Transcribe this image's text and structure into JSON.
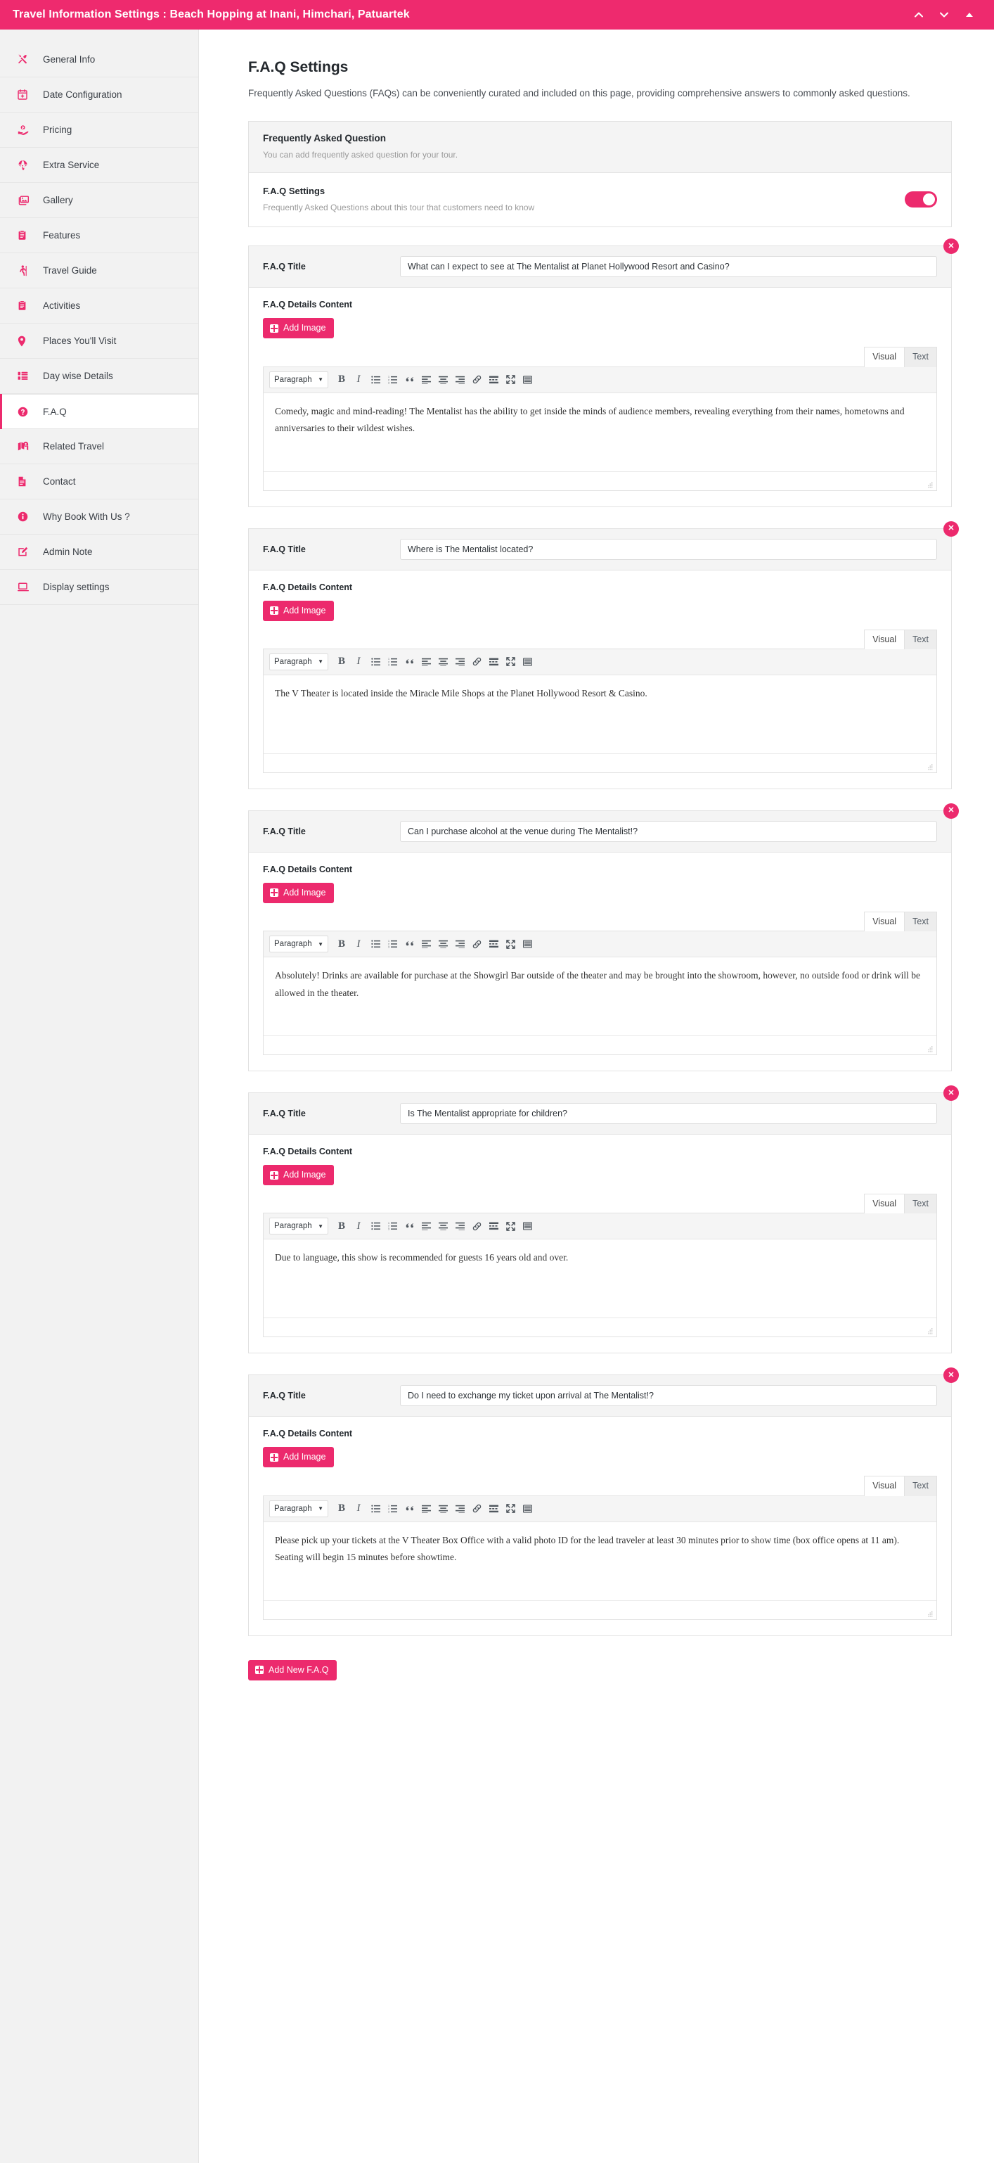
{
  "window": {
    "title": "Travel Information Settings : Beach Hopping at Inani, Himchari, Patuartek",
    "controls": [
      {
        "name": "chevron-up-icon"
      },
      {
        "name": "chevron-down-icon"
      },
      {
        "name": "triangle-up-icon"
      }
    ],
    "accent_color": "#ec2a6d",
    "titlebar_color": "#ee2a6e"
  },
  "sidebar": {
    "items": [
      {
        "label": "General Info",
        "icon": "tools-icon",
        "active": false
      },
      {
        "label": "Date Configuration",
        "icon": "calendar-plus-icon",
        "active": false
      },
      {
        "label": "Pricing",
        "icon": "hand-money-icon",
        "active": false
      },
      {
        "label": "Extra Service",
        "icon": "parachute-icon",
        "active": false
      },
      {
        "label": "Gallery",
        "icon": "images-icon",
        "active": false
      },
      {
        "label": "Features",
        "icon": "clipboard-icon",
        "active": false
      },
      {
        "label": "Travel Guide",
        "icon": "hiker-icon",
        "active": false
      },
      {
        "label": "Activities",
        "icon": "clipboard-icon",
        "active": false
      },
      {
        "label": "Places You'll Visit",
        "icon": "map-pin-icon",
        "active": false
      },
      {
        "label": "Day wise Details",
        "icon": "list-icon",
        "active": false
      },
      {
        "label": "F.A.Q",
        "icon": "question-circle-icon",
        "active": true
      },
      {
        "label": "Related Travel",
        "icon": "map-marked-icon",
        "active": false
      },
      {
        "label": "Contact",
        "icon": "file-lines-icon",
        "active": false
      },
      {
        "label": "Why Book With Us ?",
        "icon": "info-circle-icon",
        "active": false
      },
      {
        "label": "Admin Note",
        "icon": "edit-square-icon",
        "active": false
      },
      {
        "label": "Display settings",
        "icon": "monitor-icon",
        "active": false
      }
    ]
  },
  "page": {
    "title": "F.A.Q Settings",
    "description": "Frequently Asked Questions (FAQs) can be conveniently curated and included on this page, providing comprehensive answers to commonly asked questions."
  },
  "settings_card": {
    "header_title": "Frequently Asked Question",
    "header_sub": "You can add frequently asked question for your tour.",
    "row_title": "F.A.Q Settings",
    "row_sub": "Frequently Asked Questions about this tour that customers need to know",
    "toggle_on": true
  },
  "labels": {
    "faq_title": "F.A.Q Title",
    "faq_details": "F.A.Q Details Content",
    "add_image": "Add Image",
    "add_new_faq": "Add New F.A.Q",
    "tab_visual": "Visual",
    "tab_text": "Text",
    "paragraph_select": "Paragraph",
    "delete_glyph": "✕"
  },
  "toolbar_icons": [
    {
      "name": "bold-icon",
      "glyph": "B"
    },
    {
      "name": "italic-icon",
      "glyph": "I"
    },
    {
      "name": "bulleted-list-icon"
    },
    {
      "name": "numbered-list-icon"
    },
    {
      "name": "blockquote-icon"
    },
    {
      "name": "align-left-icon"
    },
    {
      "name": "align-center-icon"
    },
    {
      "name": "align-right-icon"
    },
    {
      "name": "link-icon"
    },
    {
      "name": "insert-read-more-icon"
    },
    {
      "name": "fullscreen-icon"
    },
    {
      "name": "toolbar-toggle-icon"
    }
  ],
  "faqs": [
    {
      "title": "What can I expect to see at The Mentalist at Planet Hollywood Resort and Casino?",
      "content": "Comedy, magic and mind-reading! The Mentalist has the ability to get inside the minds of audience members, revealing everything from their names, hometowns and anniversaries to their wildest wishes.",
      "active_tab": "Visual"
    },
    {
      "title": "Where is The Mentalist located?",
      "content": "The V Theater is located inside the Miracle Mile Shops at the Planet Hollywood Resort & Casino.",
      "active_tab": "Visual"
    },
    {
      "title": "Can I purchase alcohol at the venue during The Mentalist!?",
      "content": "Absolutely! Drinks are available for purchase at the Showgirl Bar outside of the theater and may be brought into the showroom, however, no outside food or drink will be allowed in the theater.",
      "active_tab": "Visual"
    },
    {
      "title": "Is The Mentalist appropriate for children?",
      "content": "Due to language, this show is recommended for guests 16 years old and over.",
      "active_tab": "Visual"
    },
    {
      "title": "Do I need to exchange my ticket upon arrival at The Mentalist!?",
      "content": "Please pick up your tickets at the V Theater Box Office with a valid photo ID for the lead traveler at least 30 minutes prior to show time (box office opens at 11 am). Seating will begin 15 minutes before showtime.",
      "active_tab": "Visual"
    }
  ]
}
